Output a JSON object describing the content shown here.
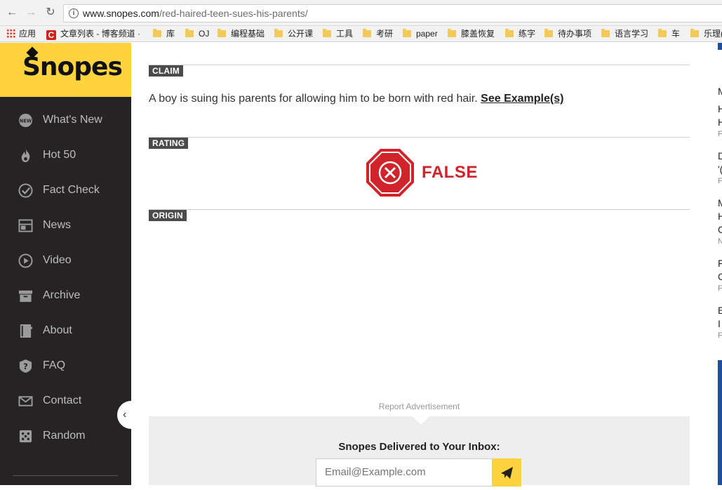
{
  "browser": {
    "url_domain": "www.snopes.com",
    "url_path": "/red-haired-teen-sues-his-parents/",
    "bookmarks": [
      {
        "label": "应用",
        "icon": "apps-grid-icon"
      },
      {
        "label": "文章列表 - 博客频道 ·",
        "icon": "csdn-logo-icon"
      },
      {
        "label": "库",
        "icon": "folder-icon"
      },
      {
        "label": "OJ",
        "icon": "folder-icon"
      },
      {
        "label": "编程基础",
        "icon": "folder-icon"
      },
      {
        "label": "公开课",
        "icon": "folder-icon"
      },
      {
        "label": "工具",
        "icon": "folder-icon"
      },
      {
        "label": "考研",
        "icon": "folder-icon"
      },
      {
        "label": "paper",
        "icon": "folder-icon"
      },
      {
        "label": "膝盖恢复",
        "icon": "folder-icon"
      },
      {
        "label": "练字",
        "icon": "folder-icon"
      },
      {
        "label": "待办事项",
        "icon": "folder-icon"
      },
      {
        "label": "语言学习",
        "icon": "folder-icon"
      },
      {
        "label": "车",
        "icon": "folder-icon"
      },
      {
        "label": "乐理(",
        "icon": "folder-icon"
      }
    ]
  },
  "sidebar": {
    "logo_text": "Snopes",
    "items": [
      {
        "label": "What's New",
        "icon": "new-badge-icon"
      },
      {
        "label": "Hot 50",
        "icon": "flame-icon"
      },
      {
        "label": "Fact Check",
        "icon": "check-circle-icon"
      },
      {
        "label": "News",
        "icon": "news-layout-icon"
      },
      {
        "label": "Video",
        "icon": "play-circle-icon"
      },
      {
        "label": "Archive",
        "icon": "archive-box-icon"
      },
      {
        "label": "About",
        "icon": "notebook-icon"
      },
      {
        "label": "FAQ",
        "icon": "question-icon"
      },
      {
        "label": "Contact",
        "icon": "envelope-icon"
      },
      {
        "label": "Random",
        "icon": "dice-icon"
      }
    ]
  },
  "article": {
    "claim_label": "CLAIM",
    "claim_text": "A boy is suing his parents for allowing him to be born with red hair.",
    "claim_link": "See Example(s)",
    "rating_label": "RATING",
    "rating_value": "FALSE",
    "origin_label": "ORIGIN"
  },
  "ad": {
    "report_label": "Report Advertisement"
  },
  "newsletter": {
    "title": "Snopes Delivered to Your Inbox:",
    "email_placeholder": "Email@Example.com"
  },
  "right_column": {
    "lines": [
      "M",
      "H",
      "H",
      "F",
      "D",
      "'(",
      "F",
      "M",
      "H",
      "C",
      "N",
      "F",
      "C",
      "F",
      "E",
      "I",
      "F"
    ]
  },
  "colors": {
    "brand_yellow": "#ffd33e",
    "sidebar_bg": "#262324",
    "false_red": "#d1232a"
  }
}
